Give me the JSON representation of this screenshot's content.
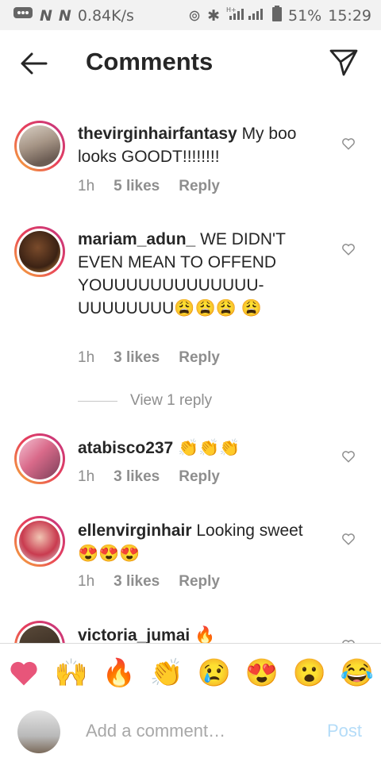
{
  "status_bar": {
    "net_speed": "0.84K/s",
    "battery": "51%",
    "time": "15:29"
  },
  "header": {
    "title": "Comments"
  },
  "comments": [
    {
      "user": "thevirginhairfantasy",
      "text": " My boo looks GOODT!!!!!!!!",
      "time": "1h",
      "likes": "5 likes",
      "reply": "Reply"
    },
    {
      "user": "mariam_adun_",
      "text": " WE DIDN'T EVEN MEAN TO OFFEND YOUUUUUUUUUUUUU-UUUUUUUU😩😩😩 😩",
      "time": "1h",
      "likes": "3 likes",
      "reply": "Reply"
    },
    {
      "user": "atabisco237",
      "text": " 👏👏👏",
      "time": "1h",
      "likes": "3 likes",
      "reply": "Reply"
    },
    {
      "user": "ellenvirginhair",
      "text": " Looking sweet 😍😍😍",
      "time": "1h",
      "likes": "3 likes",
      "reply": "Reply"
    },
    {
      "user": "victoria_jumai",
      "text": " 🔥",
      "time": "",
      "likes": "",
      "reply": ""
    }
  ],
  "view_replies": "View 1 reply",
  "quick_emojis": [
    "❤️",
    "🙌",
    "🔥",
    "👏",
    "😢",
    "😍",
    "😮",
    "😂"
  ],
  "input": {
    "placeholder": "Add a comment…",
    "post_label": "Post"
  },
  "colors": {
    "accent_heart": "#e8557a",
    "post_disabled": "#b4dcf8",
    "secondary_text": "#8e8e8e"
  }
}
